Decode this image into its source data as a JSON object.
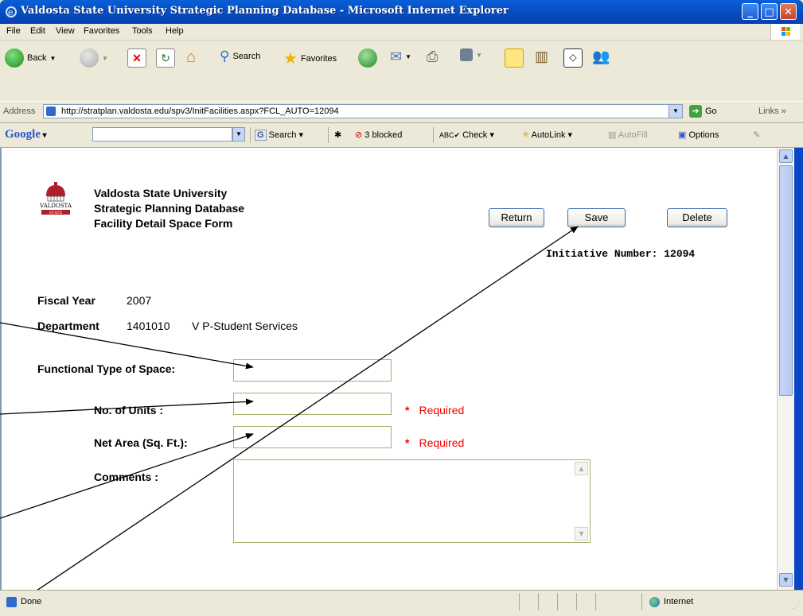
{
  "window": {
    "title": "Valdosta State University Strategic Planning Database - Microsoft Internet Explorer"
  },
  "menu": {
    "items": [
      "File",
      "Edit",
      "View",
      "Favorites",
      "Tools",
      "Help"
    ]
  },
  "toolbar": {
    "back_label": "Back",
    "search_label": "Search",
    "favorites_label": "Favorites"
  },
  "address": {
    "label": "Address",
    "url": "http://stratplan.valdosta.edu/spv3/InitFacilities.aspx?FCL_AUTO=12094",
    "go_label": "Go",
    "links_label": "Links"
  },
  "googlebar": {
    "logo": "Google",
    "search_label": "Search",
    "blocked_label": "3 blocked",
    "check_label": "Check",
    "autolink_label": "AutoLink",
    "autofill_label": "AutoFill",
    "options_label": "Options"
  },
  "page": {
    "logo_text_top": "VALDOSTA",
    "logo_text_bottom": "STATE",
    "org_line1": "Valdosta State University",
    "org_line2": "Strategic Planning Database",
    "org_line3": "Facility Detail Space Form",
    "return_label": "Return",
    "save_label": "Save",
    "delete_label": "Delete",
    "initiative_label": "Initiative Number: 12094",
    "fiscal_year_label": "Fiscal Year",
    "fiscal_year_value": "2007",
    "department_label": "Department",
    "department_code": "1401010",
    "department_name": "V P-Student Services",
    "functional_type_label": "Functional Type of Space:",
    "units_label": "No. of Units :",
    "net_area_label": "Net Area (Sq. Ft.):",
    "comments_label": "Comments :",
    "required_text": "Required"
  },
  "status": {
    "text": "Done",
    "zone": "Internet"
  }
}
